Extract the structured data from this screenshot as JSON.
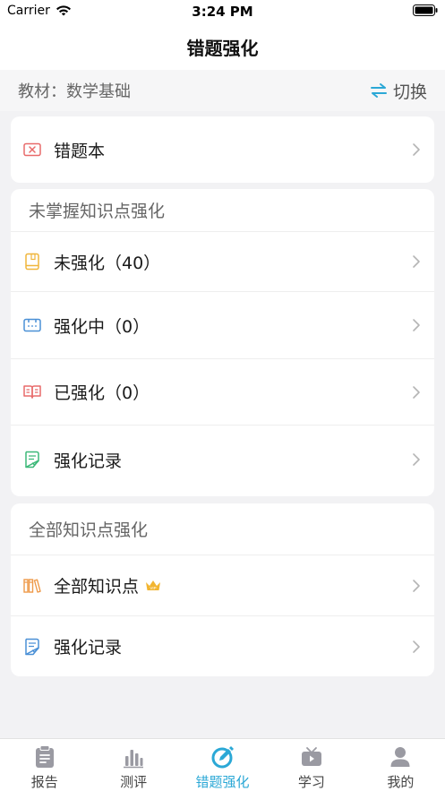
{
  "status_bar": {
    "carrier": "Carrier",
    "time": "3:24 PM"
  },
  "nav": {
    "title": "错题强化"
  },
  "textbook": {
    "label": "教材：数学基础",
    "switch_label": "切换"
  },
  "wrong_book": {
    "label": "错题本"
  },
  "unmastered": {
    "title": "未掌握知识点强化",
    "items": [
      {
        "label": "未强化（40）",
        "icon": "book-icon"
      },
      {
        "label": "强化中（0）",
        "icon": "ticket-icon"
      },
      {
        "label": "已强化（0）",
        "icon": "open-book-icon"
      },
      {
        "label": "强化记录",
        "icon": "record-icon"
      }
    ]
  },
  "all_points": {
    "title": "全部知识点强化",
    "items": [
      {
        "label": "全部知识点",
        "icon": "books-icon",
        "badge": "vip-crown-icon"
      },
      {
        "label": "强化记录",
        "icon": "record-icon"
      }
    ]
  },
  "tabs": [
    {
      "label": "报告",
      "icon": "clipboard-icon"
    },
    {
      "label": "测评",
      "icon": "bar-chart-icon"
    },
    {
      "label": "错题强化",
      "icon": "pencil-icon",
      "active": true
    },
    {
      "label": "学习",
      "icon": "tv-icon"
    },
    {
      "label": "我的",
      "icon": "person-icon"
    }
  ],
  "colors": {
    "accent": "#2ba8d6",
    "background": "#f2f2f4",
    "red_icon": "#e86a6a",
    "yellow_icon": "#f0b63c",
    "blue_icon": "#4a90d6",
    "green_icon": "#3cb878",
    "orange_icon": "#ee9a4a"
  }
}
